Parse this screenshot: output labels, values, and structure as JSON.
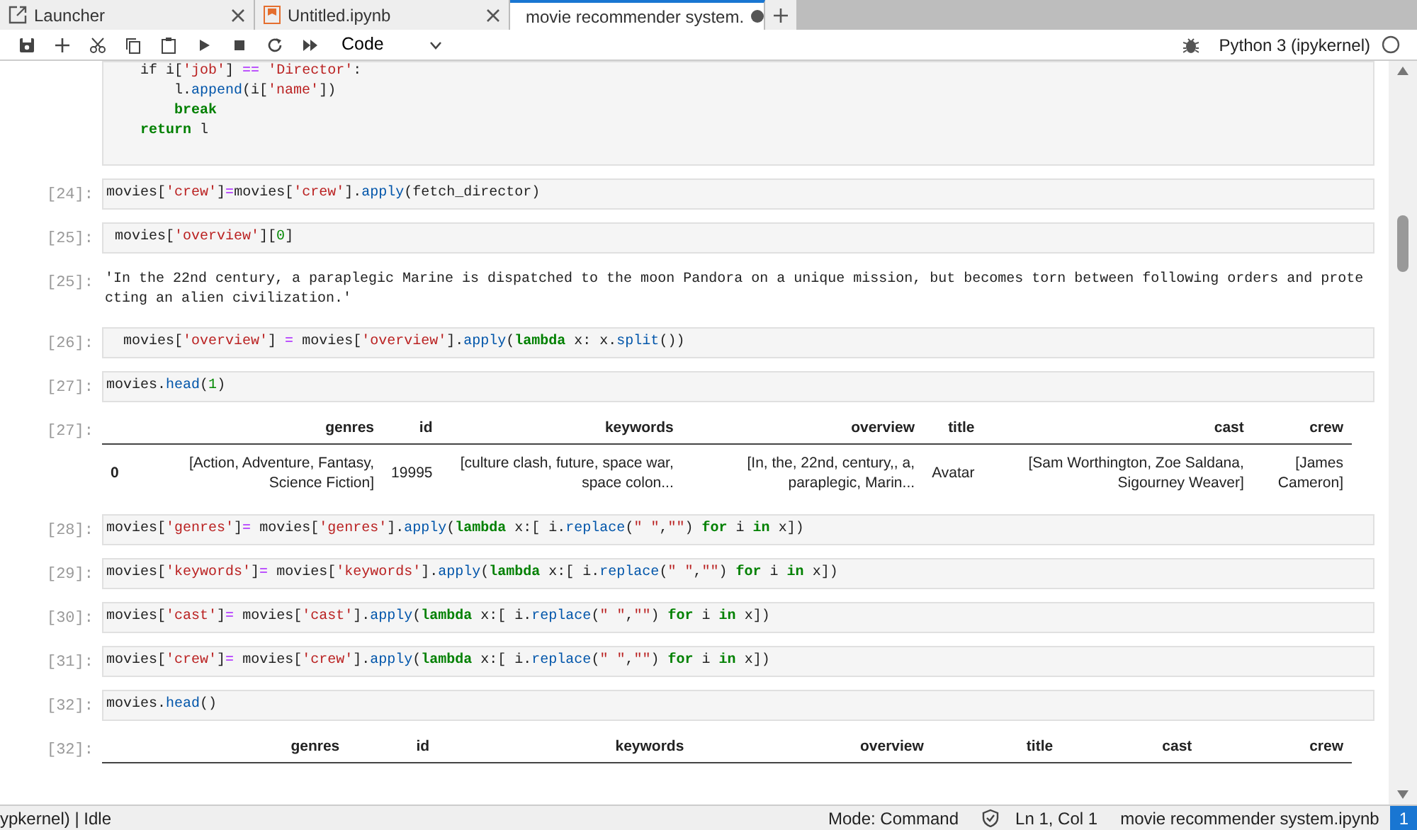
{
  "tabs": [
    {
      "label": "Launcher",
      "kind": "launcher",
      "selected": false,
      "dirty": false
    },
    {
      "label": "Untitled.ipynb",
      "kind": "notebook",
      "selected": false,
      "dirty": false
    },
    {
      "label": "movie recommender system.",
      "kind": "notebook",
      "selected": true,
      "dirty": true
    }
  ],
  "toolbar": {
    "cell_type": "Code",
    "kernel": "Python 3 (ipykernel)",
    "kernel_busy": false
  },
  "cells": [
    {
      "kind": "code",
      "lines": [
        [
          {
            "text": "    if i[",
            "kind": "n"
          },
          {
            "text": "'job'",
            "kind": "s"
          },
          {
            "text": "] ",
            "kind": "n"
          },
          {
            "text": "==",
            "kind": "o"
          },
          {
            "text": " 'Director'",
            "kind": "s"
          },
          {
            "text": ":",
            "kind": "n"
          }
        ],
        [
          {
            "text": "        l.",
            "kind": "n"
          },
          {
            "text": "append",
            "kind": "f"
          },
          {
            "text": "(i[",
            "kind": "n"
          },
          {
            "text": "'name'",
            "kind": "s"
          },
          {
            "text": "])",
            "kind": "n"
          }
        ],
        [
          {
            "text": "        break",
            "kind": "k"
          }
        ],
        [
          {
            "text": "    return",
            "kind": "k"
          },
          {
            "text": " l",
            "kind": "n"
          }
        ]
      ]
    },
    {
      "kind": "code",
      "prompt": "[24]:",
      "lines": [
        [
          {
            "text": "movies[",
            "kind": "n"
          },
          {
            "text": "'crew'",
            "kind": "s"
          },
          {
            "text": "]",
            "kind": "n"
          },
          {
            "text": "=",
            "kind": "o"
          },
          {
            "text": "movies[",
            "kind": "n"
          },
          {
            "text": "'crew'",
            "kind": "s"
          },
          {
            "text": "].",
            "kind": "n"
          },
          {
            "text": "apply",
            "kind": "f"
          },
          {
            "text": "(fetch_director)",
            "kind": "n"
          }
        ]
      ]
    },
    {
      "kind": "code",
      "prompt": "[25]:",
      "lines": [
        [
          {
            "text": " movies[",
            "kind": "n"
          },
          {
            "text": "'overview'",
            "kind": "s"
          },
          {
            "text": "][",
            "kind": "n"
          },
          {
            "text": "0",
            "kind": "d"
          },
          {
            "text": "]",
            "kind": "n"
          }
        ]
      ]
    },
    {
      "kind": "text",
      "prompt": "[25]:",
      "text": "'In the 22nd century, a paraplegic Marine is dispatched to the moon Pandora on a unique mission, but becomes torn between following orders and protecting an alien civilization.'"
    },
    {
      "kind": "code",
      "prompt": "[26]:",
      "lines": [
        [
          {
            "text": "  movies[",
            "kind": "n"
          },
          {
            "text": "'overview'",
            "kind": "s"
          },
          {
            "text": "] ",
            "kind": "n"
          },
          {
            "text": "=",
            "kind": "o"
          },
          {
            "text": " movies[",
            "kind": "n"
          },
          {
            "text": "'overview'",
            "kind": "s"
          },
          {
            "text": "].",
            "kind": "n"
          },
          {
            "text": "apply",
            "kind": "f"
          },
          {
            "text": "(",
            "kind": "n"
          },
          {
            "text": "lambda",
            "kind": "k"
          },
          {
            "text": " x: x.",
            "kind": "n"
          },
          {
            "text": "split",
            "kind": "f"
          },
          {
            "text": "())",
            "kind": "n"
          }
        ]
      ]
    },
    {
      "kind": "code",
      "prompt": "[27]:",
      "lines": [
        [
          {
            "text": "movies.",
            "kind": "n"
          },
          {
            "text": "head",
            "kind": "f"
          },
          {
            "text": "(",
            "kind": "n"
          },
          {
            "text": "1",
            "kind": "d"
          },
          {
            "text": ")",
            "kind": "n"
          }
        ]
      ]
    },
    {
      "kind": "table",
      "prompt": "[27]:",
      "columns": [
        "",
        "genres",
        "id",
        "keywords",
        "overview",
        "title",
        "cast",
        "crew"
      ],
      "rows": [
        [
          "0",
          "[Action, Adventure, Fantasy, Science Fiction]",
          "19995",
          "[culture clash, future, space war, space colon...",
          "[In, the, 22nd, century,, a, paraplegic, Marin...",
          "Avatar",
          "[Sam Worthington, Zoe Saldana, Sigourney Weaver]",
          "[James Cameron]"
        ]
      ]
    },
    {
      "kind": "code",
      "prompt": "[28]:",
      "lines": [
        [
          {
            "text": "movies[",
            "kind": "n"
          },
          {
            "text": "'genres'",
            "kind": "s"
          },
          {
            "text": "]",
            "kind": "n"
          },
          {
            "text": "=",
            "kind": "o"
          },
          {
            "text": " movies[",
            "kind": "n"
          },
          {
            "text": "'genres'",
            "kind": "s"
          },
          {
            "text": "].",
            "kind": "n"
          },
          {
            "text": "apply",
            "kind": "f"
          },
          {
            "text": "(",
            "kind": "n"
          },
          {
            "text": "lambda",
            "kind": "k"
          },
          {
            "text": " x:[ i.",
            "kind": "n"
          },
          {
            "text": "replace",
            "kind": "f"
          },
          {
            "text": "(",
            "kind": "n"
          },
          {
            "text": "\" \"",
            "kind": "s"
          },
          {
            "text": ",",
            "kind": "n"
          },
          {
            "text": "\"\"",
            "kind": "s"
          },
          {
            "text": ") ",
            "kind": "n"
          },
          {
            "text": "for",
            "kind": "k"
          },
          {
            "text": " i ",
            "kind": "n"
          },
          {
            "text": "in",
            "kind": "k"
          },
          {
            "text": " x])",
            "kind": "n"
          }
        ]
      ]
    },
    {
      "kind": "code",
      "prompt": "[29]:",
      "lines": [
        [
          {
            "text": "movies[",
            "kind": "n"
          },
          {
            "text": "'keywords'",
            "kind": "s"
          },
          {
            "text": "]",
            "kind": "n"
          },
          {
            "text": "=",
            "kind": "o"
          },
          {
            "text": " movies[",
            "kind": "n"
          },
          {
            "text": "'keywords'",
            "kind": "s"
          },
          {
            "text": "].",
            "kind": "n"
          },
          {
            "text": "apply",
            "kind": "f"
          },
          {
            "text": "(",
            "kind": "n"
          },
          {
            "text": "lambda",
            "kind": "k"
          },
          {
            "text": " x:[ i.",
            "kind": "n"
          },
          {
            "text": "replace",
            "kind": "f"
          },
          {
            "text": "(",
            "kind": "n"
          },
          {
            "text": "\" \"",
            "kind": "s"
          },
          {
            "text": ",",
            "kind": "n"
          },
          {
            "text": "\"\"",
            "kind": "s"
          },
          {
            "text": ") ",
            "kind": "n"
          },
          {
            "text": "for",
            "kind": "k"
          },
          {
            "text": " i ",
            "kind": "n"
          },
          {
            "text": "in",
            "kind": "k"
          },
          {
            "text": " x])",
            "kind": "n"
          }
        ]
      ]
    },
    {
      "kind": "code",
      "prompt": "[30]:",
      "lines": [
        [
          {
            "text": "movies[",
            "kind": "n"
          },
          {
            "text": "'cast'",
            "kind": "s"
          },
          {
            "text": "]",
            "kind": "n"
          },
          {
            "text": "=",
            "kind": "o"
          },
          {
            "text": " movies[",
            "kind": "n"
          },
          {
            "text": "'cast'",
            "kind": "s"
          },
          {
            "text": "].",
            "kind": "n"
          },
          {
            "text": "apply",
            "kind": "f"
          },
          {
            "text": "(",
            "kind": "n"
          },
          {
            "text": "lambda",
            "kind": "k"
          },
          {
            "text": " x:[ i.",
            "kind": "n"
          },
          {
            "text": "replace",
            "kind": "f"
          },
          {
            "text": "(",
            "kind": "n"
          },
          {
            "text": "\" \"",
            "kind": "s"
          },
          {
            "text": ",",
            "kind": "n"
          },
          {
            "text": "\"\"",
            "kind": "s"
          },
          {
            "text": ") ",
            "kind": "n"
          },
          {
            "text": "for",
            "kind": "k"
          },
          {
            "text": " i ",
            "kind": "n"
          },
          {
            "text": "in",
            "kind": "k"
          },
          {
            "text": " x])",
            "kind": "n"
          }
        ]
      ]
    },
    {
      "kind": "code",
      "prompt": "[31]:",
      "lines": [
        [
          {
            "text": "movies[",
            "kind": "n"
          },
          {
            "text": "'crew'",
            "kind": "s"
          },
          {
            "text": "]",
            "kind": "n"
          },
          {
            "text": "=",
            "kind": "o"
          },
          {
            "text": " movies[",
            "kind": "n"
          },
          {
            "text": "'crew'",
            "kind": "s"
          },
          {
            "text": "].",
            "kind": "n"
          },
          {
            "text": "apply",
            "kind": "f"
          },
          {
            "text": "(",
            "kind": "n"
          },
          {
            "text": "lambda",
            "kind": "k"
          },
          {
            "text": " x:[ i.",
            "kind": "n"
          },
          {
            "text": "replace",
            "kind": "f"
          },
          {
            "text": "(",
            "kind": "n"
          },
          {
            "text": "\" \"",
            "kind": "s"
          },
          {
            "text": ",",
            "kind": "n"
          },
          {
            "text": "\"\"",
            "kind": "s"
          },
          {
            "text": ") ",
            "kind": "n"
          },
          {
            "text": "for",
            "kind": "k"
          },
          {
            "text": " i ",
            "kind": "n"
          },
          {
            "text": "in",
            "kind": "k"
          },
          {
            "text": " x])",
            "kind": "n"
          }
        ]
      ]
    },
    {
      "kind": "code",
      "prompt": "[32]:",
      "lines": [
        [
          {
            "text": "movies.",
            "kind": "n"
          },
          {
            "text": "head",
            "kind": "f"
          },
          {
            "text": "()",
            "kind": "n"
          }
        ]
      ]
    },
    {
      "kind": "table",
      "prompt": "[32]:",
      "columns": [
        "",
        "genres",
        "id",
        "keywords",
        "overview",
        "title",
        "cast",
        "crew"
      ]
    }
  ],
  "status_bar": {
    "left": "ypkernel) | Idle",
    "mode": "Mode: Command",
    "position": "Ln 1, Col 1",
    "file": "movie recommender system.ipynb",
    "badge": "1"
  }
}
